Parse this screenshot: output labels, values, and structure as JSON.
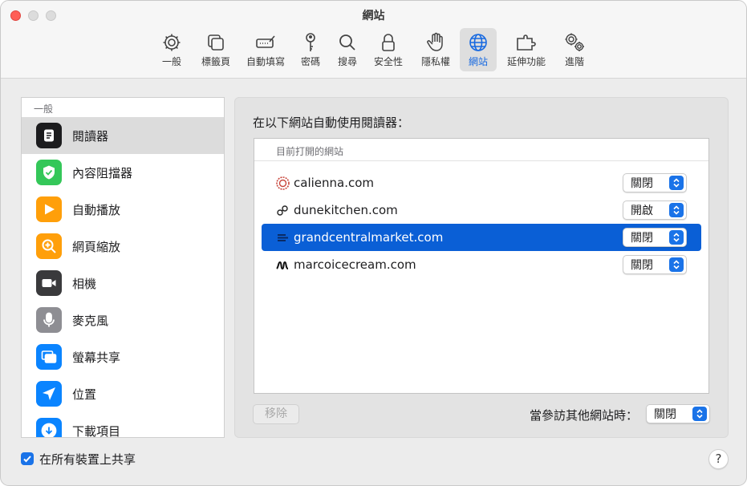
{
  "window": {
    "title": "網站"
  },
  "toolbar": {
    "items": [
      {
        "label": "一般",
        "icon": "gear-icon"
      },
      {
        "label": "標籤頁",
        "icon": "tabs-icon"
      },
      {
        "label": "自動填寫",
        "icon": "autofill-icon"
      },
      {
        "label": "密碼",
        "icon": "key-icon"
      },
      {
        "label": "搜尋",
        "icon": "magnifier-icon"
      },
      {
        "label": "安全性",
        "icon": "lock-icon"
      },
      {
        "label": "隱私權",
        "icon": "hand-icon"
      },
      {
        "label": "網站",
        "icon": "globe-icon",
        "active": true
      },
      {
        "label": "延伸功能",
        "icon": "puzzle-icon"
      },
      {
        "label": "進階",
        "icon": "gears-icon"
      }
    ]
  },
  "sidebar": {
    "section": "一般",
    "items": [
      {
        "label": "閱讀器",
        "icon": "reader-icon",
        "color": "#1c1c1e",
        "selected": true
      },
      {
        "label": "內容阻擋器",
        "icon": "shield-check-icon",
        "color": "#34c759"
      },
      {
        "label": "自動播放",
        "icon": "play-icon",
        "color": "#ff9f0a"
      },
      {
        "label": "網頁縮放",
        "icon": "zoom-icon",
        "color": "#ff9f0a"
      },
      {
        "label": "相機",
        "icon": "camera-icon",
        "color": "#3a3a3c"
      },
      {
        "label": "麥克風",
        "icon": "microphone-icon",
        "color": "#8e8e93"
      },
      {
        "label": "螢幕共享",
        "icon": "screen-share-icon",
        "color": "#0a84ff"
      },
      {
        "label": "位置",
        "icon": "location-arrow-icon",
        "color": "#0a84ff"
      },
      {
        "label": "下載項目",
        "icon": "download-icon",
        "color": "#0a84ff"
      }
    ]
  },
  "main": {
    "heading": "在以下網站自動使用閱讀器：",
    "list_header": "目前打開的網站",
    "sites": [
      {
        "name": "calienna.com",
        "value": "關閉",
        "icon": "calienna-favicon"
      },
      {
        "name": "dunekitchen.com",
        "value": "開啟",
        "icon": "dunekitchen-favicon"
      },
      {
        "name": "grandcentralmarket.com",
        "value": "關閉",
        "icon": "grandcentral-favicon",
        "selected": true
      },
      {
        "name": "marcoicecream.com",
        "value": "關閉",
        "icon": "marco-favicon"
      }
    ],
    "remove_label": "移除",
    "other_label": "當參訪其他網站時：",
    "other_value": "關閉"
  },
  "footer": {
    "share_label": "在所有裝置上共享",
    "share_checked": true,
    "help_label": "?"
  },
  "colors": {
    "accent": "#1a73e8",
    "selection": "#0a5fd6"
  }
}
